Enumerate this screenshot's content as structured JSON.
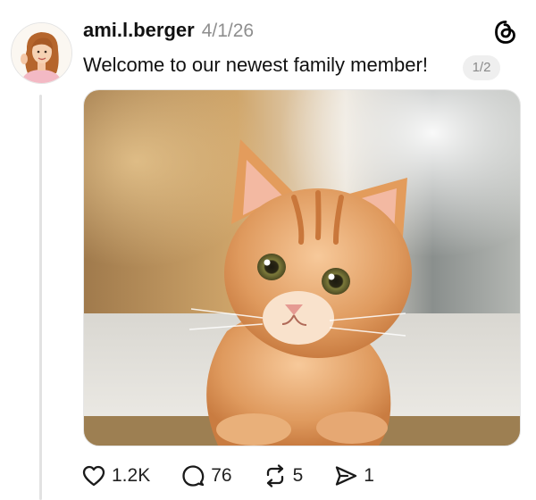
{
  "post": {
    "username": "ami.l.berger",
    "date": "4/1/26",
    "text": "Welcome to our newest family member!",
    "page_indicator": "1/2",
    "avatar_icon": "illustrated-woman-avatar",
    "image_subject": "orange-kitten-photo"
  },
  "app": {
    "logo_icon": "threads-logo-icon"
  },
  "actions": {
    "likes": "1.2K",
    "comments": "76",
    "reposts": "5",
    "shares": "1"
  }
}
